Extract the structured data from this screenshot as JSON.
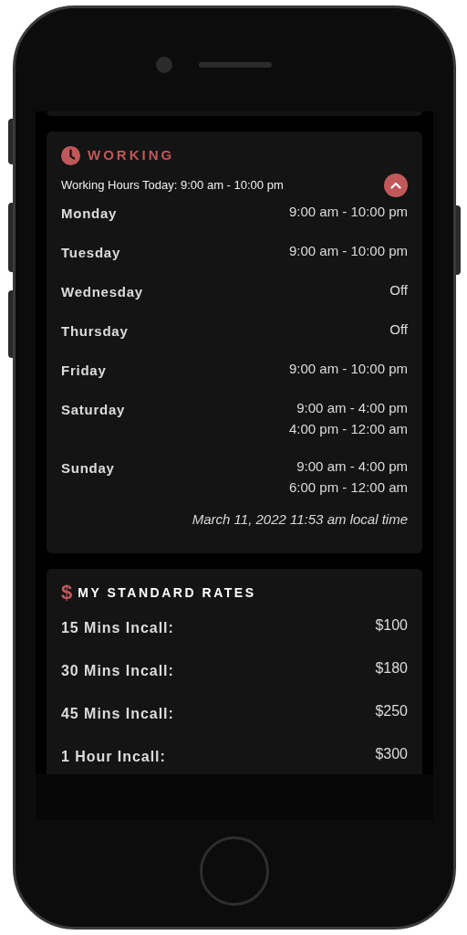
{
  "working": {
    "title": "WORKING",
    "today": "Working Hours Today: 9:00 am - 10:00 pm",
    "expanded": true,
    "days": [
      {
        "day": "Monday",
        "hours": [
          "9:00 am - 10:00 pm"
        ]
      },
      {
        "day": "Tuesday",
        "hours": [
          "9:00 am - 10:00 pm"
        ]
      },
      {
        "day": "Wednesday",
        "hours": [
          "Off"
        ]
      },
      {
        "day": "Thursday",
        "hours": [
          "Off"
        ]
      },
      {
        "day": "Friday",
        "hours": [
          "9:00 am - 10:00 pm"
        ]
      },
      {
        "day": "Saturday",
        "hours": [
          "9:00 am - 4:00 pm",
          "4:00 pm - 12:00 am"
        ]
      },
      {
        "day": "Sunday",
        "hours": [
          "9:00 am - 4:00 pm",
          "6:00 pm - 12:00 am"
        ]
      }
    ],
    "local_time": "March 11, 2022 11:53 am local time"
  },
  "rates": {
    "icon": "$",
    "title": "MY STANDARD RATES",
    "items": [
      {
        "label": "15 Mins Incall:",
        "price": "$100"
      },
      {
        "label": "30 Mins Incall:",
        "price": "$180"
      },
      {
        "label": "45 Mins Incall:",
        "price": "$250"
      },
      {
        "label": "1 Hour Incall:",
        "price": "$300"
      }
    ]
  }
}
